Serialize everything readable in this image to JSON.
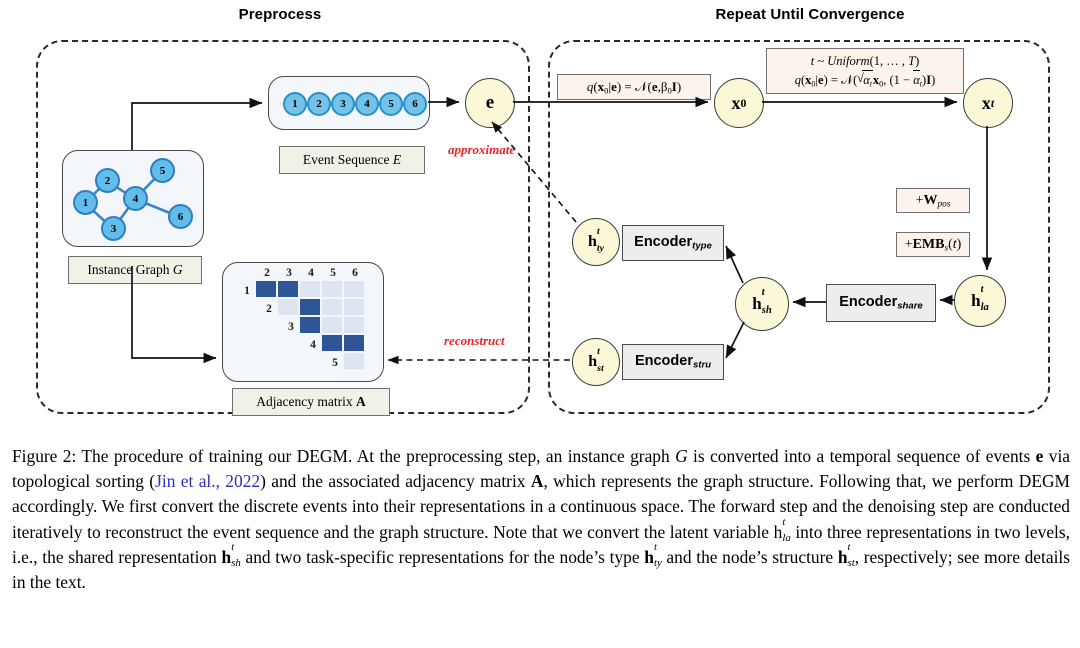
{
  "figure": {
    "panels": [
      {
        "id": "preprocess",
        "title": "Preprocess"
      },
      {
        "id": "repeat",
        "title": "Repeat Until Convergence"
      }
    ],
    "event_sequence": {
      "caption": "Event Sequence E",
      "events": [
        "1",
        "2",
        "3",
        "4",
        "5",
        "6"
      ]
    },
    "instance_graph": {
      "caption": "Instance Graph G",
      "nodes": [
        "1",
        "2",
        "3",
        "4",
        "5",
        "6"
      ],
      "edges": [
        [
          "1",
          "2"
        ],
        [
          "1",
          "3"
        ],
        [
          "2",
          "4"
        ],
        [
          "3",
          "4"
        ],
        [
          "4",
          "5"
        ],
        [
          "4",
          "6"
        ]
      ]
    },
    "adjacency_matrix": {
      "caption": "Adjacency matrix A",
      "col_labels": [
        "2",
        "3",
        "4",
        "5",
        "6"
      ],
      "row_labels": [
        "1",
        "2",
        "3",
        "4",
        "5"
      ],
      "cells": [
        [
          1,
          1,
          0,
          0,
          0
        ],
        [
          null,
          0,
          1,
          0,
          0
        ],
        [
          null,
          null,
          1,
          0,
          0
        ],
        [
          null,
          null,
          null,
          1,
          1
        ],
        [
          null,
          null,
          null,
          null,
          0
        ]
      ],
      "color_filled": "#2e5596",
      "color_empty": "#dde4f2"
    },
    "nodes": {
      "e": "e",
      "x0": "x0",
      "xt": "xt",
      "h_la": "h_la^t",
      "h_sh": "h_sh^t",
      "h_ty": "h_ty^t",
      "h_st": "h_st^t"
    },
    "formulas": {
      "q_x0_e": "q(x0|e) = N(e, β0 I)",
      "t_uniform": "t ~ Uniform(1, ..., T)",
      "q_xt": "q(x0|e) = N(√āt x0, (1 − āt)I)",
      "w_pos": "+Wpos",
      "emb_s": "+EMBs(t)"
    },
    "encoders": {
      "type": "Encoder",
      "type_sub": "type",
      "stru": "Encoder",
      "stru_sub": "stru",
      "share": "Encoder",
      "share_sub": "share"
    },
    "edge_labels": {
      "approximate": "approximate",
      "reconstruct": "reconstruct"
    },
    "colors": {
      "node_fill": "#fbf8d8",
      "event_fill": "#72c2e9",
      "graph_node_fill": "#62bdea",
      "matrix_dark": "#2e5596",
      "matrix_light": "#dde4f2",
      "red_label": "#e8262b",
      "citation_blue": "#2b2fb5"
    }
  },
  "caption": {
    "label": "Figure 2:",
    "citation": "Jin et al., 2022",
    "part1": " The procedure of training our DEGM. At the preprocessing step, an instance graph ",
    "g_sym": "G",
    "part2": " is converted into a temporal sequence of events ",
    "e_sym": "e",
    "part3": " via topological sorting (",
    "part4": ") and the associated adjacency matrix ",
    "a_sym": "A",
    "part5": ", which represents the graph structure. Following that, we perform DEGM accordingly. We first convert the discrete events into their representations in a continuous space. The forward step and the denoising step are conducted iteratively to reconstruct the event sequence and the graph structure. Note that we convert the latent variable ",
    "part6": " into three representations in two levels, i.e., the shared representation ",
    "part7": " and two task-specific representations for the node’s type ",
    "part8": " and the node’s structure ",
    "part9": ", respectively; see more details in the text."
  }
}
